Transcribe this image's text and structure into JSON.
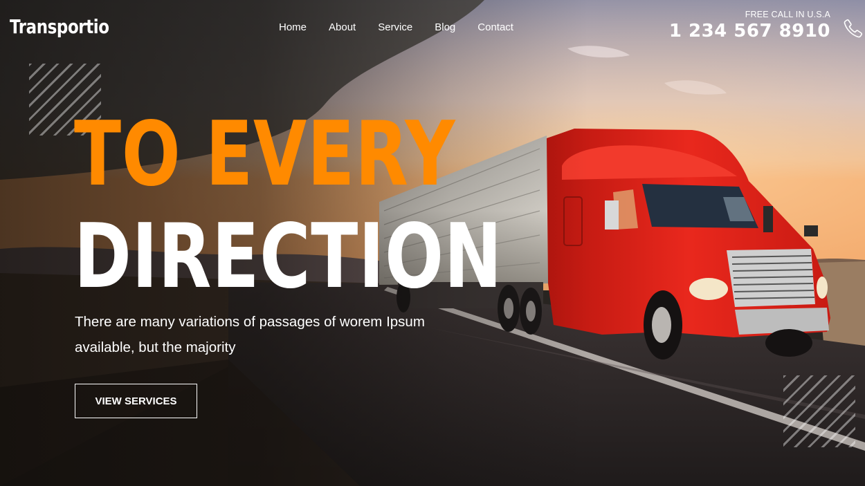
{
  "brand": {
    "name": "Transportio"
  },
  "nav": {
    "items": [
      {
        "label": "Home"
      },
      {
        "label": "About"
      },
      {
        "label": "Service"
      },
      {
        "label": "Blog"
      },
      {
        "label": "Contact"
      }
    ]
  },
  "contact": {
    "label": "FREE CALL IN U.S.A",
    "phone": "1 234 567 8910",
    "icon": "phone-icon"
  },
  "hero": {
    "headline_line1": "TO EVERY",
    "headline_line2": "DIRECTION",
    "description": "There are many variations of passages of worem Ipsum available, but the majority",
    "cta_label": "VIEW SERVICES",
    "background_image": "red semi-truck with silver trailer driving on a desert highway at sunset"
  },
  "colors": {
    "accent": "#ff8a00",
    "text": "#ffffff",
    "truck": "#e0251b"
  }
}
